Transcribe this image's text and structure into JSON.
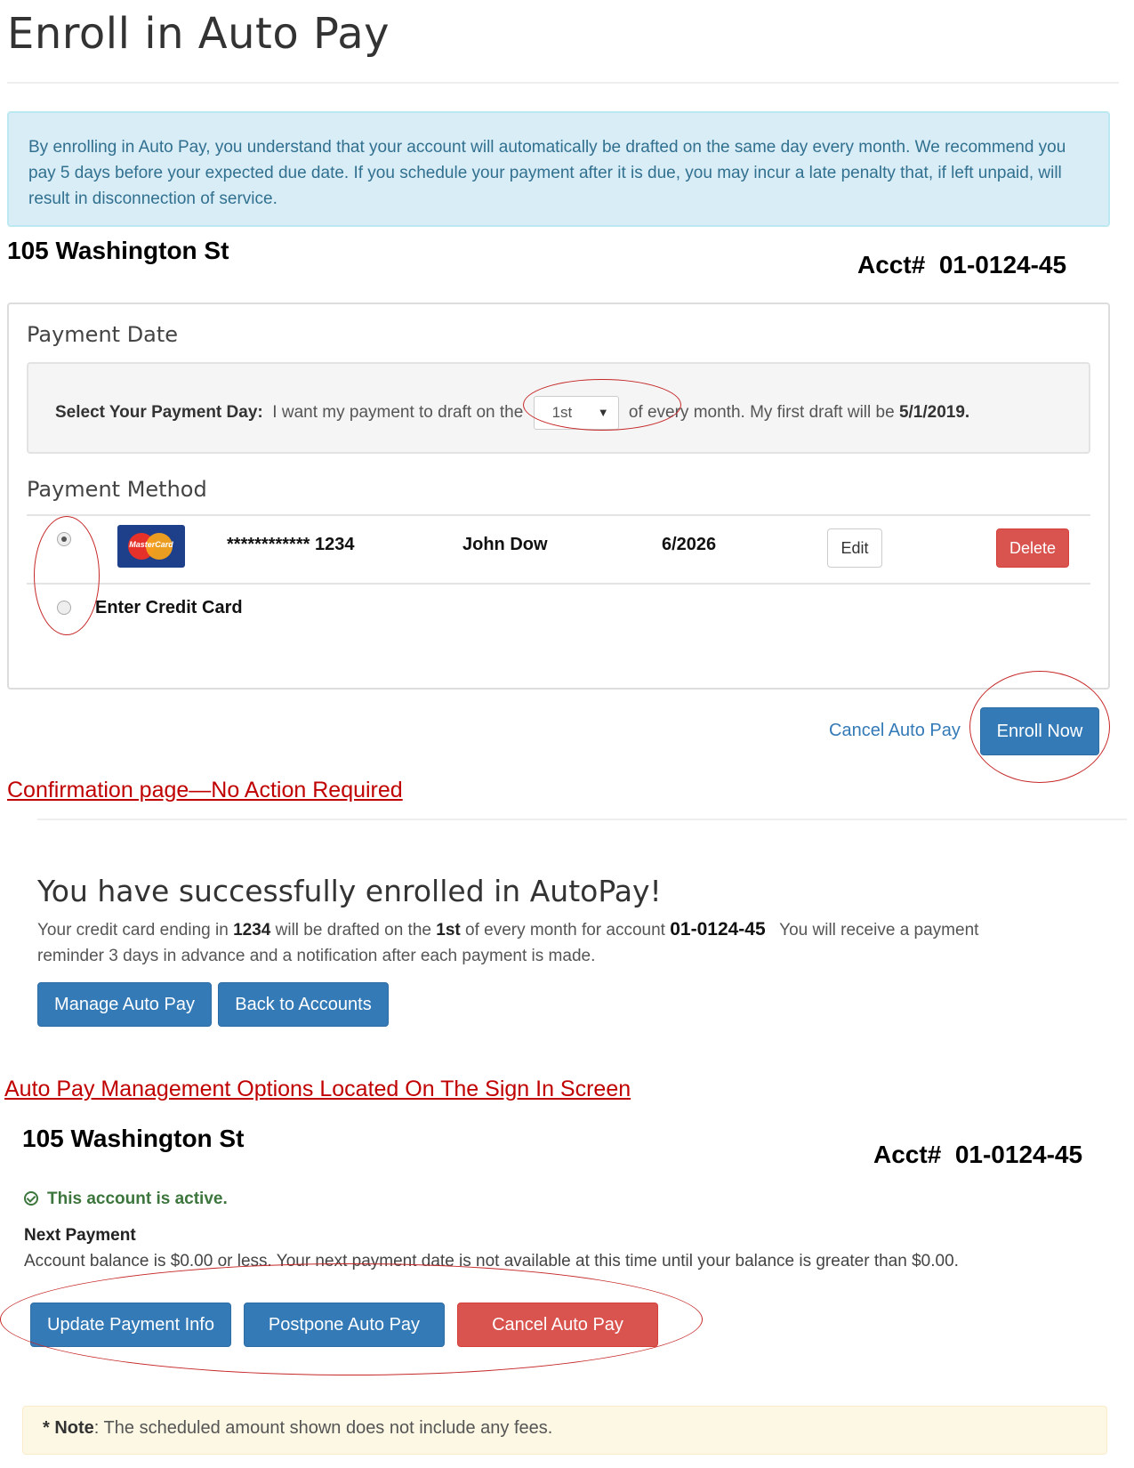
{
  "page": {
    "title": "Enroll in Auto Pay"
  },
  "info_alert": {
    "text": "By enrolling in Auto Pay, you understand that your account will automatically be drafted on the same day every month. We recommend you pay 5 days before your expected due date. If you schedule your payment after it is due, you may incur a late penalty that, if left unpaid, will result in disconnection of service."
  },
  "account": {
    "address": "105 Washington St",
    "acct_label": "Acct#",
    "acct_number": "01-0124-45"
  },
  "payment_date": {
    "heading": "Payment Date",
    "label": "Select Your Payment Day:",
    "text_before": "I want my payment to draft on the",
    "selected_day": "1st",
    "text_after": "of every month. My first draft will be",
    "first_draft_date": "5/1/2019."
  },
  "payment_method": {
    "heading": "Payment Method",
    "card": {
      "brand": "MasterCard",
      "masked_number": "************ 1234",
      "holder": "John Dow",
      "expiry": "6/2026",
      "edit_label": "Edit",
      "delete_label": "Delete",
      "selected": true
    },
    "enter_card_label": "Enter Credit Card"
  },
  "actions": {
    "cancel_label": "Cancel Auto Pay",
    "enroll_label": "Enroll Now"
  },
  "confirmation_heading": "Confirmation page—No Action Required",
  "confirmation": {
    "title": "You have successfully enrolled in AutoPay!",
    "text1": "Your credit card ending in",
    "last4": "1234",
    "text2": "will be drafted on the",
    "day": "1st",
    "text3": "of every month for account",
    "account": "01-0124-45",
    "text4": "You will receive a payment",
    "line2": "reminder 3 days in advance and a notification after each payment is made.",
    "manage_label": "Manage Auto Pay",
    "back_label": "Back to Accounts"
  },
  "management_heading": "Auto Pay Management Options Located On The Sign In Screen",
  "management": {
    "address": "105 Washington St",
    "acct_label": "Acct#",
    "acct_number": "01-0124-45",
    "status_text": "This account is active.",
    "next_payment_label": "Next Payment",
    "next_payment_text": "Account balance is $0.00 or less. Your next payment date is not available at this time until your balance is greater than $0.00.",
    "update_label": "Update Payment Info",
    "postpone_label": "Postpone Auto Pay",
    "cancel_label": "Cancel Auto Pay"
  },
  "note": {
    "prefix": "* Note",
    "text": ": The scheduled amount shown does not include any fees."
  },
  "colors": {
    "primary": "#337ab7",
    "danger": "#d9534f",
    "info_bg": "#d9edf7",
    "warning_bg": "#fcf8e3",
    "success": "#3c763d",
    "annotation_red": "#c00000"
  }
}
